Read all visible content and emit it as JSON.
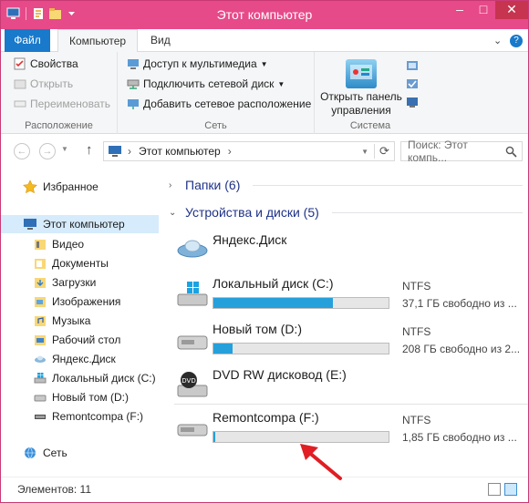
{
  "window": {
    "title": "Этот компьютер",
    "controls": {
      "minimize": "–",
      "maximize": "□",
      "close": "✕"
    }
  },
  "ribbon_tabs": {
    "file": "Файл",
    "computer": "Компьютер",
    "view": "Вид",
    "expand": "⌄",
    "help": "?"
  },
  "ribbon": {
    "location_group": {
      "label": "Расположение",
      "properties": "Свойства",
      "open": "Открыть",
      "rename": "Переименовать"
    },
    "network_group": {
      "label": "Сеть",
      "media_access": "Доступ к мультимедиа",
      "map_drive": "Подключить сетевой диск",
      "add_location": "Добавить сетевое расположение"
    },
    "system_group": {
      "label": "Система",
      "control_panel_line1": "Открыть панель",
      "control_panel_line2": "управления"
    }
  },
  "navigation": {
    "back": "←",
    "forward": "→",
    "up": "↑",
    "address_path": "Этот компьютер",
    "address_sep": "›",
    "search_placeholder": "Поиск: Этот компь..."
  },
  "nav_pane": {
    "favorites": "Избранное",
    "this_pc": "Этот компьютер",
    "items": [
      "Видео",
      "Документы",
      "Загрузки",
      "Изображения",
      "Музыка",
      "Рабочий стол",
      "Яндекс.Диск",
      "Локальный диск (C:)",
      "Новый том (D:)",
      "Remontcompa (F:)"
    ],
    "network": "Сеть"
  },
  "main": {
    "folders_header": "Папки (6)",
    "devices_header": "Устройства и диски (5)",
    "drives": [
      {
        "name": "Яндекс.Диск",
        "fs": "",
        "free": ""
      },
      {
        "name": "Локальный диск (C:)",
        "fs": "NTFS",
        "free": "37,1 ГБ свободно из ...",
        "used_fraction": 0.68
      },
      {
        "name": "Новый том (D:)",
        "fs": "NTFS",
        "free": "208 ГБ свободно из 2...",
        "used_fraction": 0.11
      },
      {
        "name": "DVD RW дисковод (E:)",
        "fs": "",
        "free": ""
      },
      {
        "name": "Remontcompa (F:)",
        "fs": "NTFS",
        "free": "1,85 ГБ свободно из ...",
        "used_fraction": 0.01
      }
    ]
  },
  "status": {
    "items_count": "Элементов: 11"
  },
  "colors": {
    "titlebar": "#e64a89",
    "file_tab": "#1979ca",
    "drive_fill": "#26a0da",
    "selection": "#d6ebfb",
    "annotation_arrow": "#e01e24"
  }
}
